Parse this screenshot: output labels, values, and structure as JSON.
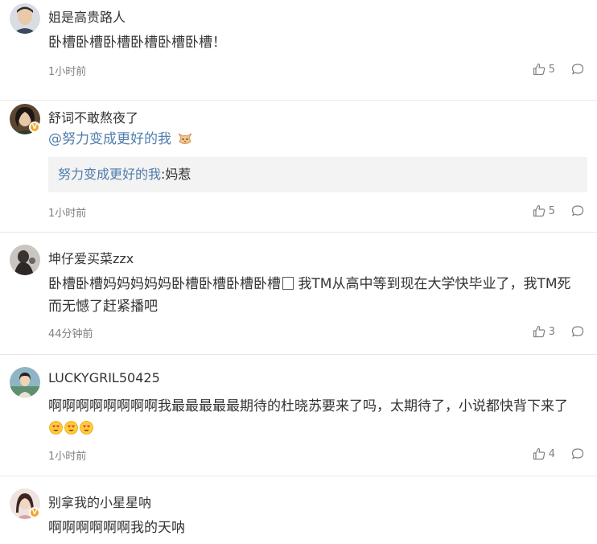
{
  "comments": [
    {
      "username": "姐是高贵路人",
      "text": "卧槽卧槽卧槽卧槽卧槽卧槽！",
      "time": "1小时前",
      "likes": "5",
      "verified": false
    },
    {
      "username": "舒词不敢熬夜了",
      "mention": "@努力变成更好的我",
      "quote_name": "努力变成更好的我",
      "quote_sep": ":",
      "quote_text": "妈惹",
      "time": "1小时前",
      "likes": "5",
      "verified": true
    },
    {
      "username": "坤仔爱买菜zzx",
      "text_a": "卧槽卧槽妈妈妈妈妈卧槽卧槽卧槽卧槽",
      "text_b": " 我TM从高中等到现在大学快毕业了，我TM死而无憾了赶紧播吧",
      "time": "44分钟前",
      "likes": "3",
      "verified": false
    },
    {
      "username": "LUCKYGRIL50425",
      "text": "啊啊啊啊啊啊啊啊我最最最最最期待的杜晓苏要来了吗，太期待了，小说都快背下来了",
      "time": "1小时前",
      "likes": "4",
      "verified": false
    },
    {
      "username": "别拿我的小星星呐",
      "text": "啊啊啊啊啊啊我的天呐",
      "verified": true
    }
  ],
  "colors": {
    "link": "#4f7dac",
    "meta": "#808080",
    "divider": "#e8e8e8",
    "verified_badge": "#f5a623"
  },
  "icons": {
    "like": "thumbs-up-icon",
    "reply": "comment-bubble-icon",
    "emoji": "heart-eyes-emoji",
    "cat": "cat-face-emoji"
  }
}
